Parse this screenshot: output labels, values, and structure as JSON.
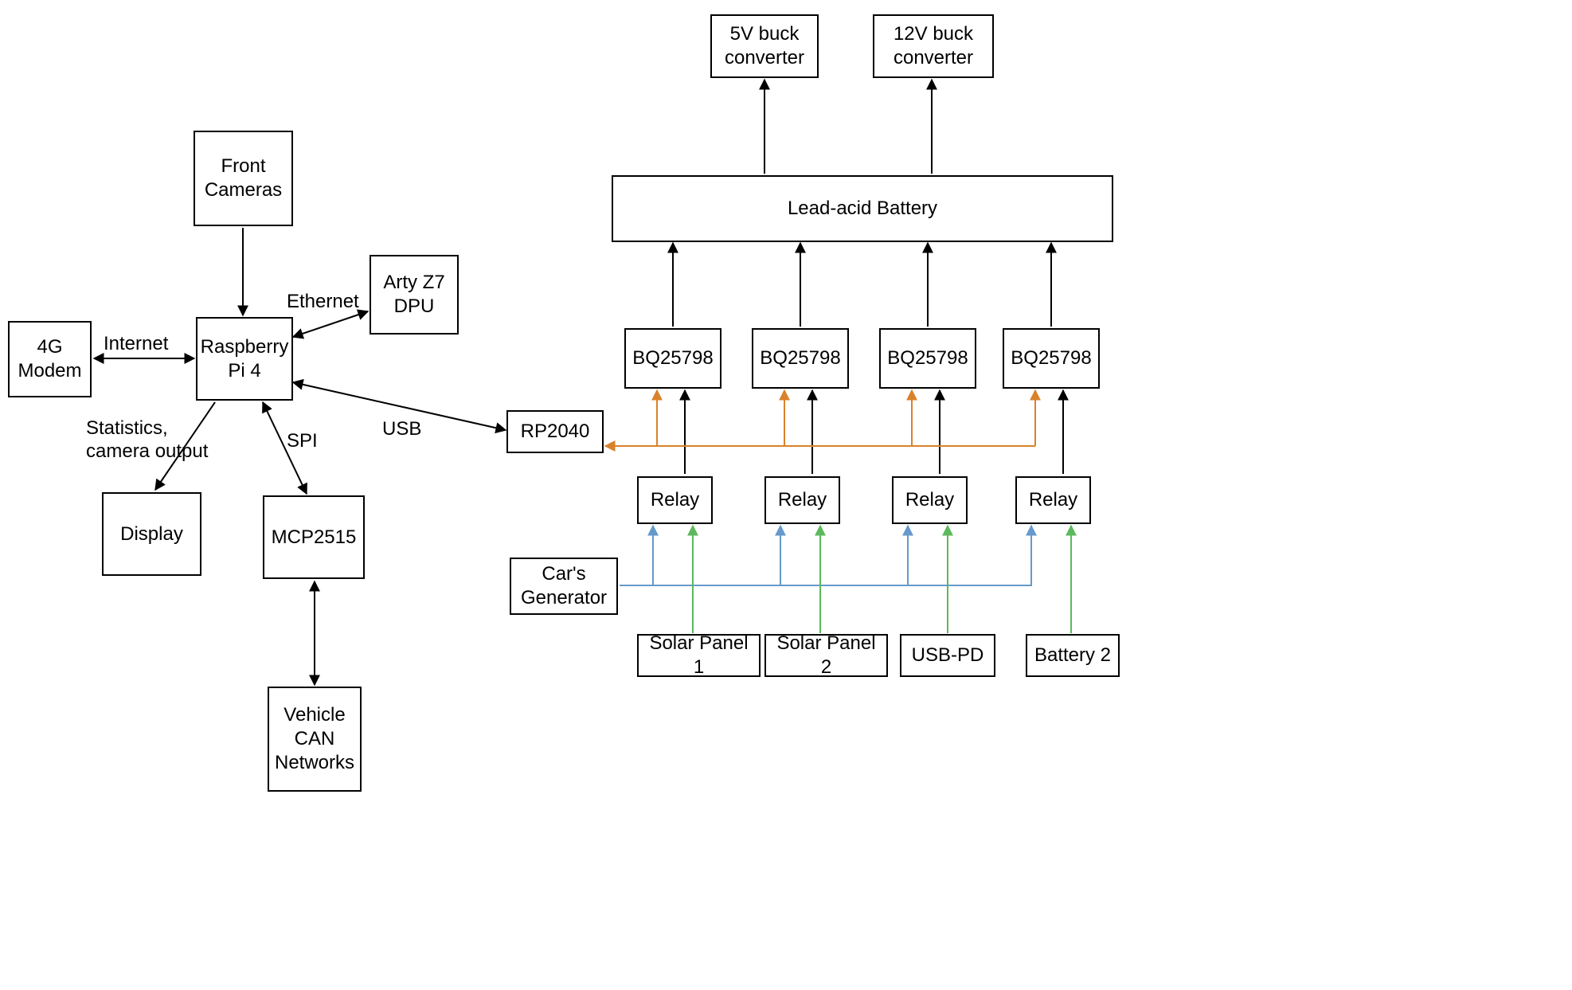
{
  "nodes": {
    "front_cameras": "Front\nCameras",
    "modem_4g": "4G\nModem",
    "raspberry_pi": "Raspberry\nPi 4",
    "arty_z7": "Arty Z7\nDPU",
    "display": "Display",
    "mcp2515": "MCP2515",
    "vehicle_can": "Vehicle\nCAN\nNetworks",
    "rp2040": "RP2040",
    "car_generator": "Car's\nGenerator",
    "solar_panel_1": "Solar Panel 1",
    "solar_panel_2": "Solar Panel 2",
    "usb_pd": "USB-PD",
    "battery_2": "Battery 2",
    "relay_1": "Relay",
    "relay_2": "Relay",
    "relay_3": "Relay",
    "relay_4": "Relay",
    "bq_1": "BQ25798",
    "bq_2": "BQ25798",
    "bq_3": "BQ25798",
    "bq_4": "BQ25798",
    "lead_acid": "Lead-acid Battery",
    "buck_5v": "5V buck\nconverter",
    "buck_12v": "12V buck\nconverter"
  },
  "labels": {
    "internet": "Internet",
    "ethernet": "Ethernet",
    "stats": "Statistics,\ncamera output",
    "spi": "SPI",
    "usb": "USB"
  },
  "colors": {
    "black": "#000000",
    "orange": "#d9822b",
    "blue": "#6699cc",
    "green": "#5cb85c"
  }
}
